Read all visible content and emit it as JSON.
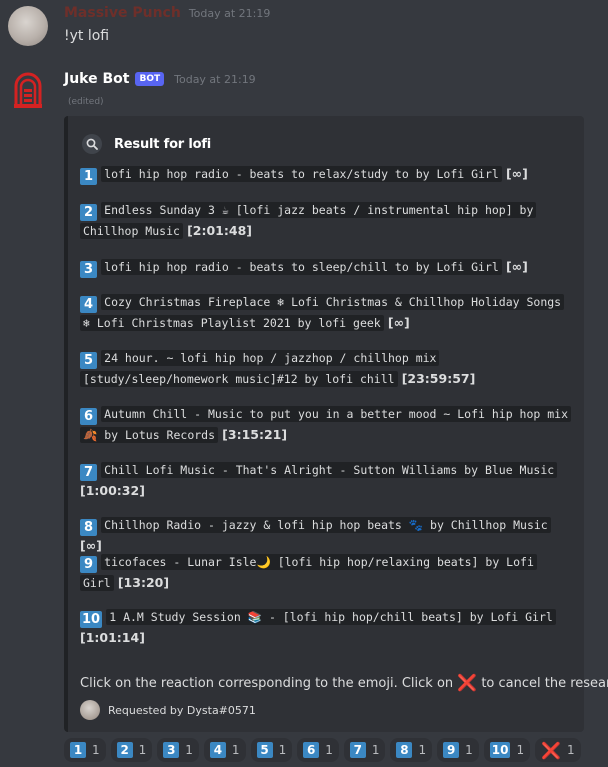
{
  "message1": {
    "author": "Massive Punch",
    "timestamp": "Today at 21:19",
    "content": "!yt lofi"
  },
  "message2": {
    "author": "Juke Bot",
    "badge": "BOT",
    "timestamp": "Today at 21:19",
    "edited": "(edited)"
  },
  "embed": {
    "title": "Result for lofi",
    "results": [
      {
        "num": "1",
        "text": "lofi hip hop radio - beats to relax/study to by Lofi Girl",
        "duration": "[∞]"
      },
      {
        "num": "2",
        "text": "Endless Sunday 3 ☕ [lofi jazz beats / instrumental hip hop] by Chillhop Music",
        "duration": "[2:01:48]"
      },
      {
        "num": "3",
        "text": "lofi hip hop radio - beats to sleep/chill to by Lofi Girl",
        "duration": "[∞]"
      },
      {
        "num": "4",
        "text": "Cozy Christmas Fireplace ❄ Lofi Christmas & Chillhop Holiday Songs ❄ Lofi Christmas Playlist 2021 by lofi geek",
        "duration": "[∞]"
      },
      {
        "num": "5",
        "text": "24 hour. ~ lofi hip hop / jazzhop / chillhop mix [study/sleep/homework music]#12 by lofi chill",
        "duration": "[23:59:57]"
      },
      {
        "num": "6",
        "text": "Autumn Chill - Music to put you in a better mood ~ Lofi hip hop mix 🍂 by Lotus Records",
        "duration": "[3:15:21]"
      },
      {
        "num": "7",
        "text": "Chill Lofi Music - That's Alright - Sutton Williams by Blue Music",
        "duration": "[1:00:32]"
      },
      {
        "num": "8",
        "text": "Chillhop Radio - jazzy & lofi hip hop beats 🐾 by Chillhop Music",
        "duration": "[∞]"
      },
      {
        "num": "9",
        "text": "ticofaces - Lunar Isle🌙 [lofi hip hop/relaxing beats] by Lofi Girl",
        "duration": "[13:20]"
      },
      {
        "num": "10",
        "text": "1 A.M Study Session 📚 - [lofi hip hop/chill beats] by Lofi Girl",
        "duration": "[1:01:14]"
      }
    ],
    "hint_before": "Click on the reaction corresponding to the emoji. Click on ",
    "hint_mark": "❌",
    "hint_after": " to cancel the research.",
    "footer": "Requested by Dysta#0571"
  },
  "reactions": [
    {
      "emoji": "1",
      "count": "1"
    },
    {
      "emoji": "2",
      "count": "1"
    },
    {
      "emoji": "3",
      "count": "1"
    },
    {
      "emoji": "4",
      "count": "1"
    },
    {
      "emoji": "5",
      "count": "1"
    },
    {
      "emoji": "6",
      "count": "1"
    },
    {
      "emoji": "7",
      "count": "1"
    },
    {
      "emoji": "8",
      "count": "1"
    },
    {
      "emoji": "9",
      "count": "1"
    },
    {
      "emoji": "10",
      "count": "1"
    },
    {
      "emoji": "❌",
      "count": "1"
    }
  ],
  "icons": {
    "user_avatar": "avatar-icon",
    "bot_avatar": "jukebox-icon",
    "embed_icon": "search-icon"
  },
  "colors": {
    "background": "#36393f",
    "embed": "#2f3136",
    "keycap": "#3b88c3",
    "bot_badge": "#5865f2",
    "cancel": "#dd2e44",
    "bot_logo": "#d42222"
  }
}
